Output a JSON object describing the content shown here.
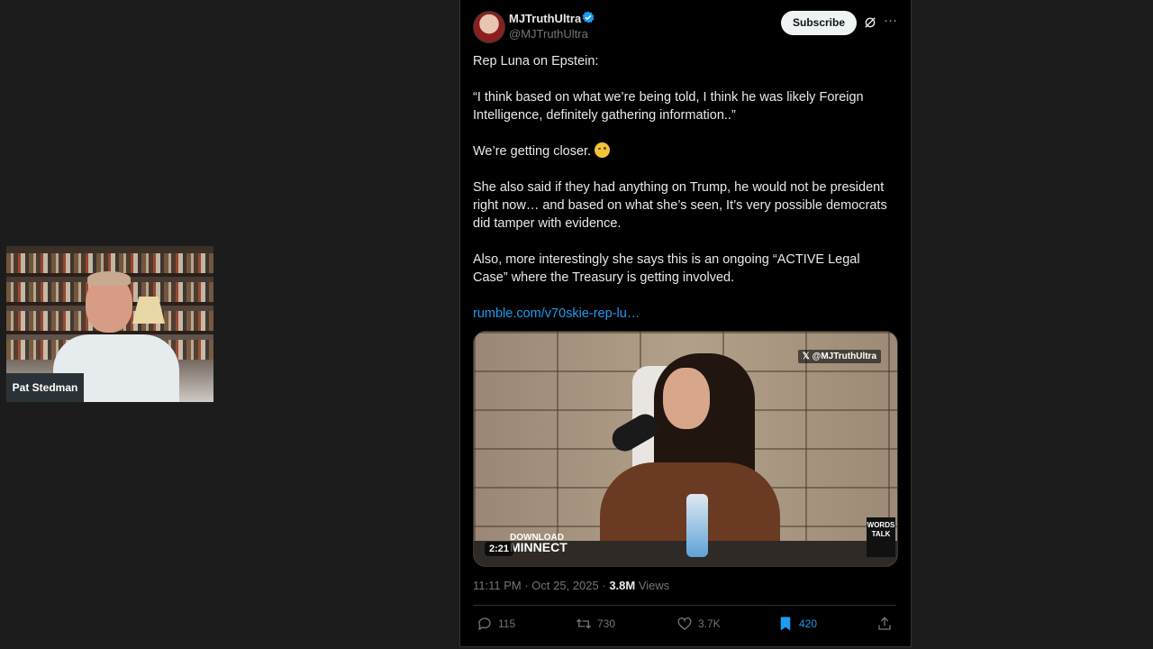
{
  "webcam": {
    "participant_name": "Pat Stedman"
  },
  "tweet": {
    "author_name": "MJTruthUltra",
    "author_handle": "@MJTruthUltra",
    "subscribe_label": "Subscribe",
    "paragraphs": {
      "p1": "Rep Luna on Epstein:",
      "p2": "“I think based on what we’re being told, I think he was likely Foreign Intelligence, definitely gathering information..”",
      "p3": "We’re getting closer.",
      "p4": "She also said if they had anything on Trump, he would not be president right now… and based on what she’s seen, It’s very possible democrats did tamper with evidence.",
      "p5": "Also, more interestingly she says this is an ongoing “ACTIVE Legal Case” where the Treasury is getting involved."
    },
    "link_text": "rumble.com/v70skie-rep-lu…",
    "media": {
      "watermark": "@MJTruthUltra",
      "duration": "2:21",
      "logo_line1": "DOWNLOAD",
      "logo_line2": "MINNECT",
      "sign_line1": "WORDS",
      "sign_line2": "TALK"
    },
    "time": "11:11 PM",
    "date": "Oct 25, 2025",
    "views_count": "3.8M",
    "views_label": "Views",
    "replies": "115",
    "retweets": "730",
    "likes": "3.7K",
    "bookmarks": "420"
  },
  "colors": {
    "accent": "#1d9bf0",
    "background": "#000000",
    "secondary_text": "#71767b"
  }
}
